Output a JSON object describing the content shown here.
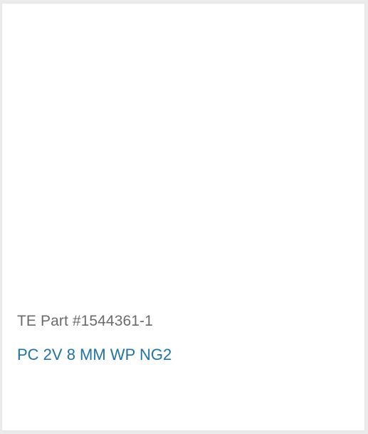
{
  "product": {
    "part_number": "TE Part #1544361-1",
    "name": "PC 2V 8 MM WP NG2"
  },
  "colors": {
    "link": "#1f73a6",
    "muted_text": "#6b6b6b",
    "background": "#ebebeb",
    "card": "#ffffff"
  }
}
